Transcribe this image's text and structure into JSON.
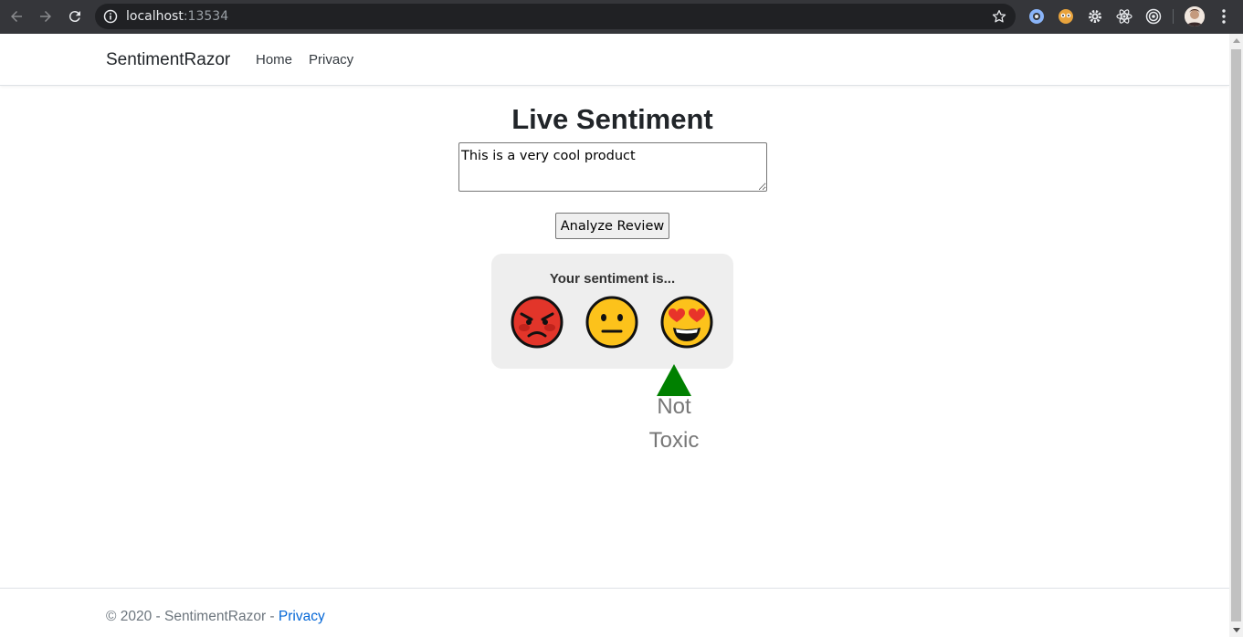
{
  "browser": {
    "url_host": "localhost",
    "url_port": ":13534",
    "icons": [
      "back-icon",
      "forward-icon",
      "reload-icon",
      "info-icon",
      "star-icon",
      "extension-icon",
      "menu-icon"
    ]
  },
  "navbar": {
    "brand": "SentimentRazor",
    "links": [
      "Home",
      "Privacy"
    ]
  },
  "main": {
    "title": "Live Sentiment",
    "review_text": "This is a very cool product",
    "button_label": "Analyze Review",
    "panel_title": "Your sentiment is...",
    "emojis": [
      "angry-face",
      "neutral-face",
      "heart-eyes-face"
    ],
    "verdict_line1": "Not",
    "verdict_line2": "Toxic",
    "pointer_color": "#008000"
  },
  "footer": {
    "copyright": "© 2020 - SentimentRazor - ",
    "privacy_link": "Privacy"
  }
}
